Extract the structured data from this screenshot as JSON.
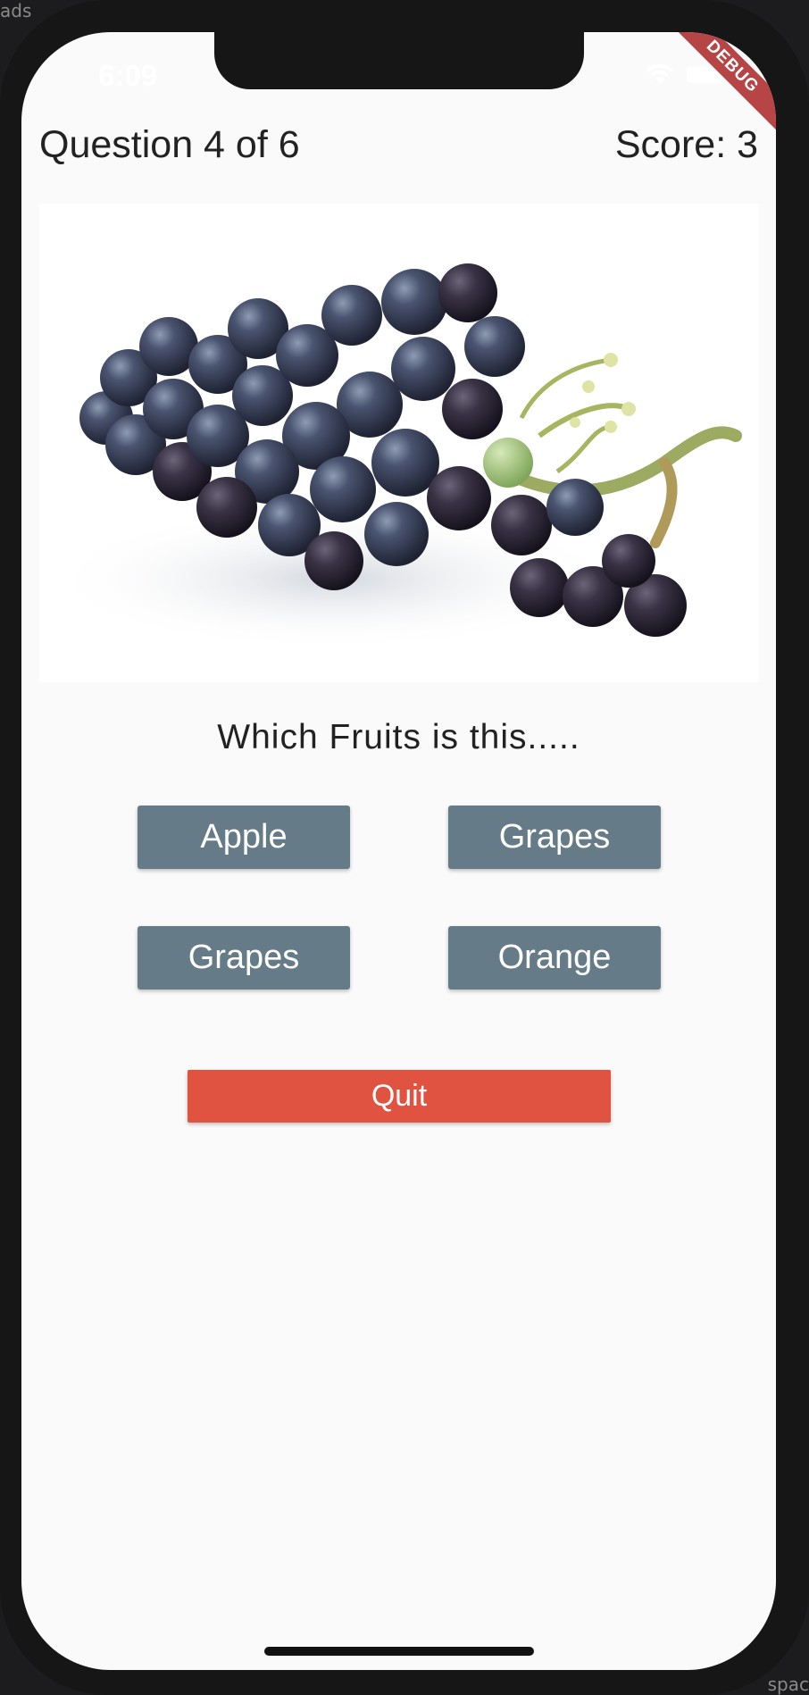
{
  "desktop": {
    "top_left_label": "ads",
    "bottom_right_label": "spac"
  },
  "status_bar": {
    "time": "6:09",
    "debug_badge": "DEBUG",
    "icons": [
      "wifi-icon",
      "battery-icon"
    ]
  },
  "header": {
    "question_progress": "Question 4 of 6",
    "score": "Score: 3"
  },
  "image": {
    "subject_icon": "grapes-photo"
  },
  "question": {
    "text": "Which Fruits is this....."
  },
  "options": [
    {
      "label": "Apple"
    },
    {
      "label": "Grapes"
    },
    {
      "label": "Grapes"
    },
    {
      "label": "Orange"
    }
  ],
  "quit_button": {
    "label": "Quit"
  },
  "colors": {
    "option_button": "#667b88",
    "quit_button": "#e05340",
    "background": "#fafafa",
    "debug_ribbon": "#b84545"
  }
}
